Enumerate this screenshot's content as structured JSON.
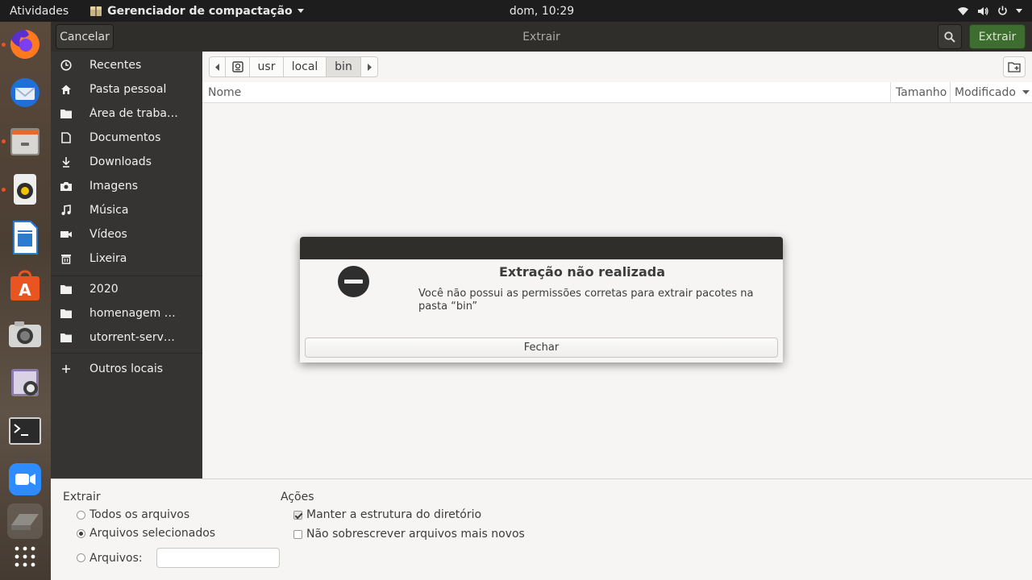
{
  "topbar": {
    "activities": "Atividades",
    "app_name": "Gerenciador de compactação",
    "clock": "dom, 10:29",
    "icons": [
      "wifi-icon",
      "volume-icon",
      "power-icon"
    ]
  },
  "dock": {
    "apps": [
      "firefox-icon",
      "thunderbird-icon",
      "file-manager-icon",
      "rhythmbox-icon",
      "libreoffice-writer-icon",
      "ubuntu-software-icon",
      "screenshot-icon",
      "cheese-icon",
      "terminal-icon",
      "zoom-icon",
      "archive-manager-icon",
      "show-apps-icon"
    ]
  },
  "headerbar": {
    "cancel_label": "Cancelar",
    "title": "Extrair",
    "extract_label": "Extrair"
  },
  "sidebar": {
    "items": [
      {
        "label": "Recentes",
        "icon": "clock-icon"
      },
      {
        "label": "Pasta pessoal",
        "icon": "home-icon"
      },
      {
        "label": "Área de trabalho",
        "icon": "folder-icon"
      },
      {
        "label": "Documentos",
        "icon": "document-icon"
      },
      {
        "label": "Downloads",
        "icon": "download-icon"
      },
      {
        "label": "Imagens",
        "icon": "camera-icon"
      },
      {
        "label": "Música",
        "icon": "music-icon"
      },
      {
        "label": "Vídeos",
        "icon": "video-icon"
      },
      {
        "label": "Lixeira",
        "icon": "trash-icon"
      },
      {
        "label": "2020",
        "icon": "folder-icon"
      },
      {
        "label": "homenagem g...",
        "icon": "folder-icon"
      },
      {
        "label": "utorrent-serve...",
        "icon": "folder-icon"
      },
      {
        "label": "Outros locais",
        "icon": "plus-icon"
      }
    ]
  },
  "pathbar": {
    "segments": [
      "usr",
      "local",
      "bin"
    ],
    "active": "bin"
  },
  "columns": {
    "name": "Nome",
    "size": "Tamanho",
    "modified": "Modificado"
  },
  "options": {
    "extract_heading": "Extrair",
    "all_files": "Todos os arquivos",
    "selected_files": "Arquivos selecionados",
    "files": "Arquivos:",
    "files_value": "",
    "selected_radio": "selected_files",
    "actions_heading": "Ações",
    "keep_structure": "Manter a estrutura do diretório",
    "keep_structure_checked": true,
    "no_overwrite": "Não sobrescrever arquivos mais novos",
    "no_overwrite_checked": false
  },
  "dialog": {
    "title": "Extração não realizada",
    "message": "Você não possui as permissões corretas para extrair pacotes na pasta “bin”",
    "close_label": "Fechar",
    "icon": "stop-icon"
  }
}
